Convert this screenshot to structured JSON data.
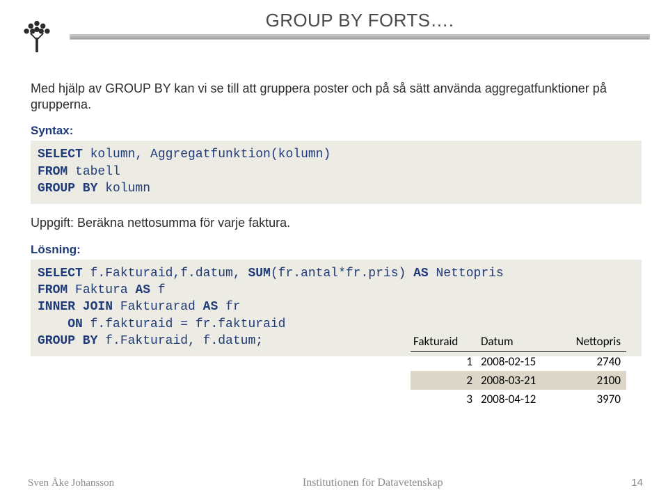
{
  "header": {
    "title_html": "GROUP BY <span class='sc'>FORTS</span>…."
  },
  "intro": "Med hjälp av GROUP BY kan vi se till att gruppera poster och på så sätt använda aggregatfunktioner på grupperna.",
  "labels": {
    "syntax": "Syntax:",
    "solution": "Lösning:"
  },
  "syntax_code": "SELECT kolumn, Aggregatfunktion(kolumn)\nFROM tabell\nGROUP BY kolumn",
  "task": "Uppgift: Beräkna nettosumma för varje faktura.",
  "solution_code": "SELECT f.Fakturaid,f.datum, SUM(fr.antal*fr.pris) AS Nettopris\nFROM Faktura AS f\nINNER JOIN Fakturarad AS fr\n    ON f.fakturaid = fr.fakturaid\nGROUP BY f.Fakturaid, f.datum;",
  "table": {
    "headers": [
      "Fakturaid",
      "Datum",
      "Nettopris"
    ],
    "rows": [
      {
        "id": "1",
        "date": "2008-02-15",
        "net": "2740"
      },
      {
        "id": "2",
        "date": "2008-03-21",
        "net": "2100"
      },
      {
        "id": "3",
        "date": "2008-04-12",
        "net": "3970"
      }
    ]
  },
  "footer": {
    "author": "Sven Åke Johansson",
    "institution": "Institutionen för Datavetenskap",
    "page": "14"
  }
}
